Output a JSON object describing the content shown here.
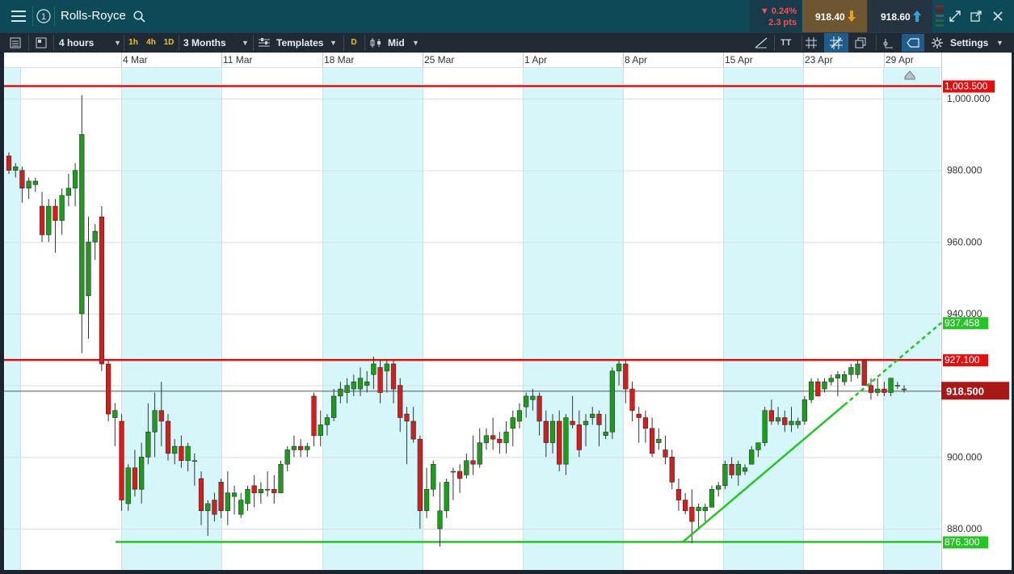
{
  "header": {
    "instrument": "Rolls-Royce",
    "change_pct": "▼ 0.24%",
    "change_pts": "2.3 pts",
    "sell_price": "918.40",
    "buy_price": "918.60",
    "colors": {
      "bar": "#0d4a57",
      "sell_bg": "#7a5a2a",
      "buy_bg": "#2a3440",
      "change_text": "#ff4d4d"
    }
  },
  "toolbar": {
    "interval": "4 hours",
    "tf_1h": "1h",
    "tf_4h": "4h",
    "tf_1d": "1D",
    "range": "3 Months",
    "templates": "Templates",
    "d_badge": "D",
    "price_mode": "Mid",
    "text_tool": "TT",
    "settings": "Settings"
  },
  "chart_data": {
    "type": "candlestick",
    "instrument": "Rolls-Royce",
    "x_labels": [
      "4 Mar",
      "11 Mar",
      "18 Mar",
      "25 Mar",
      "1 Apr",
      "8 Apr",
      "15 Apr",
      "23 Apr",
      "29 Apr"
    ],
    "y_ticks": [
      "1,000.000",
      "980.000",
      "960.000",
      "940.000",
      "900.000",
      "880.000"
    ],
    "ylim": [
      871.5,
      1010
    ],
    "grid": true,
    "colors": {
      "up": "#1f9a1f",
      "down": "#d01f1f",
      "resistance": "#e01010",
      "support": "#27c427",
      "session_band": "#d6f7fa"
    },
    "horizontal_lines": [
      {
        "label": "1,003.500",
        "value": 1003.5,
        "color": "#e01010"
      },
      {
        "label": "927.100",
        "value": 927.1,
        "color": "#e01010"
      },
      {
        "label": "876.300",
        "value": 876.3,
        "color": "#27c427"
      }
    ],
    "current_price": {
      "label": "918.500",
      "value": 918.5
    },
    "trendline": {
      "projected_label": "937.458",
      "projected_value": 937.458,
      "start": {
        "date": "11 Apr",
        "value": 876.3
      },
      "end": {
        "date": "25 Apr",
        "value": 937.458
      }
    },
    "candles": [
      [
        984,
        985,
        979,
        980
      ],
      [
        980,
        982,
        978,
        981
      ],
      [
        980,
        981,
        971,
        975
      ],
      [
        975,
        978,
        972,
        977
      ],
      [
        976,
        978,
        974,
        977
      ],
      [
        970,
        974,
        960,
        962
      ],
      [
        962,
        972,
        960,
        970
      ],
      [
        970,
        972,
        957,
        966
      ],
      [
        966,
        975,
        962,
        973
      ],
      [
        973,
        979,
        970,
        975
      ],
      [
        975,
        982,
        970,
        980
      ],
      [
        940,
        1001,
        929,
        990
      ],
      [
        945,
        967,
        933,
        960
      ],
      [
        960,
        965,
        955,
        963
      ],
      [
        967,
        970,
        924,
        926
      ],
      [
        926,
        927,
        910,
        912
      ],
      [
        911,
        915,
        903,
        913
      ],
      [
        910,
        912,
        885,
        888
      ],
      [
        887,
        898,
        885,
        897
      ],
      [
        897,
        902,
        889,
        891
      ],
      [
        891,
        904,
        887,
        900
      ],
      [
        900,
        915,
        898,
        907
      ],
      [
        907,
        918,
        900,
        913
      ],
      [
        913,
        921,
        903,
        910
      ],
      [
        910,
        912,
        899,
        901
      ],
      [
        901,
        905,
        898,
        903
      ],
      [
        903,
        906,
        897,
        899
      ],
      [
        899,
        904,
        896,
        903
      ],
      [
        899,
        901,
        892,
        899
      ],
      [
        894,
        896,
        881,
        885
      ],
      [
        885,
        888,
        878,
        887
      ],
      [
        888,
        890,
        882,
        884
      ],
      [
        893,
        894,
        883,
        885
      ],
      [
        885,
        896,
        881,
        890
      ],
      [
        889,
        892,
        884,
        890
      ],
      [
        884,
        890,
        883,
        888
      ],
      [
        887,
        892,
        885,
        891
      ],
      [
        892,
        895,
        886,
        890
      ],
      [
        890,
        893,
        887,
        891
      ],
      [
        891,
        896,
        889,
        891
      ],
      [
        891,
        895,
        887,
        890
      ],
      [
        890,
        899,
        890,
        898
      ],
      [
        898,
        903,
        896,
        902
      ],
      [
        902,
        906,
        900,
        903
      ],
      [
        903,
        905,
        900,
        902
      ],
      [
        902,
        904,
        900,
        903
      ],
      [
        917,
        918,
        903,
        906
      ],
      [
        906,
        913,
        903,
        909
      ],
      [
        909,
        912,
        906,
        911
      ],
      [
        911,
        919,
        910,
        917
      ],
      [
        917,
        921,
        915,
        919
      ],
      [
        918,
        922,
        915,
        920
      ],
      [
        919,
        923,
        917,
        921
      ],
      [
        919,
        925,
        917,
        922
      ],
      [
        920,
        924,
        918,
        921
      ],
      [
        923,
        928,
        919,
        926
      ],
      [
        925,
        927,
        915,
        918
      ],
      [
        924,
        927,
        918,
        926
      ],
      [
        926,
        927,
        915,
        919
      ],
      [
        920,
        922,
        907,
        911
      ],
      [
        912,
        914,
        898,
        910
      ],
      [
        910,
        914,
        904,
        905
      ],
      [
        905,
        906,
        880,
        885
      ],
      [
        885,
        897,
        883,
        891
      ],
      [
        891,
        899,
        889,
        898
      ],
      [
        880,
        893,
        875,
        885
      ],
      [
        885,
        894,
        883,
        893
      ],
      [
        896,
        897,
        888,
        896
      ],
      [
        896,
        898,
        890,
        894
      ],
      [
        895,
        901,
        894,
        899
      ],
      [
        899,
        906,
        895,
        898
      ],
      [
        898,
        908,
        897,
        904
      ],
      [
        904,
        908,
        902,
        906
      ],
      [
        906,
        911,
        902,
        905
      ],
      [
        905,
        907,
        901,
        904
      ],
      [
        904,
        910,
        901,
        907
      ],
      [
        908,
        913,
        903,
        911
      ],
      [
        910,
        915,
        908,
        913
      ],
      [
        914,
        918,
        911,
        917
      ],
      [
        916,
        919,
        913,
        917
      ],
      [
        917,
        918,
        906,
        910
      ],
      [
        910,
        913,
        900,
        904
      ],
      [
        904,
        912,
        901,
        910
      ],
      [
        910,
        913,
        896,
        898
      ],
      [
        898,
        912,
        895,
        911
      ],
      [
        910,
        917,
        908,
        909
      ],
      [
        909,
        913,
        900,
        902
      ],
      [
        909,
        912,
        903,
        910
      ],
      [
        911,
        914,
        909,
        912
      ],
      [
        912,
        913,
        903,
        909
      ],
      [
        906,
        912,
        905,
        907
      ],
      [
        907,
        925,
        905,
        924
      ],
      [
        924,
        927,
        920,
        926
      ],
      [
        926,
        927,
        915,
        919
      ],
      [
        919,
        921,
        910,
        913
      ],
      [
        912,
        914,
        904,
        911
      ],
      [
        911,
        913,
        904,
        908
      ],
      [
        908,
        911,
        900,
        901
      ],
      [
        904,
        908,
        902,
        905
      ],
      [
        902,
        906,
        898,
        900
      ],
      [
        900,
        902,
        891,
        893
      ],
      [
        891,
        894,
        885,
        888
      ],
      [
        888,
        890,
        884,
        885
      ],
      [
        886,
        891,
        876,
        882
      ],
      [
        885,
        887,
        880,
        886
      ],
      [
        885,
        887,
        882,
        886
      ],
      [
        886,
        892,
        886,
        891
      ],
      [
        891,
        893,
        889,
        892
      ],
      [
        892,
        899,
        891,
        898
      ],
      [
        898,
        900,
        894,
        895
      ],
      [
        895,
        899,
        892,
        898
      ],
      [
        896,
        898,
        895,
        897
      ],
      [
        898,
        903,
        898,
        902
      ],
      [
        902,
        904,
        900,
        904
      ],
      [
        904,
        914,
        903,
        913
      ],
      [
        913,
        916,
        909,
        910
      ],
      [
        910,
        914,
        909,
        911
      ],
      [
        911,
        913,
        907,
        909
      ],
      [
        909,
        914,
        907,
        910
      ],
      [
        909,
        911,
        908,
        910
      ],
      [
        910,
        917,
        909,
        916
      ],
      [
        916,
        922,
        915,
        921
      ],
      [
        921,
        922,
        917,
        917
      ],
      [
        919,
        922,
        918,
        921
      ],
      [
        921,
        923,
        920,
        922
      ],
      [
        922,
        924,
        917,
        923
      ],
      [
        921,
        924,
        920,
        923
      ],
      [
        923,
        926,
        921,
        925
      ],
      [
        923,
        927,
        922,
        926
      ],
      [
        927,
        927,
        920,
        920
      ],
      [
        920,
        922,
        916,
        918
      ],
      [
        918,
        922,
        917,
        919
      ],
      [
        919,
        921,
        917,
        918
      ],
      [
        918,
        922,
        917,
        922
      ],
      [
        920,
        921,
        919,
        920
      ],
      [
        919,
        920,
        918,
        919
      ]
    ]
  },
  "right_tools": {
    "colors": {
      "active": "#1e5d8a"
    }
  }
}
